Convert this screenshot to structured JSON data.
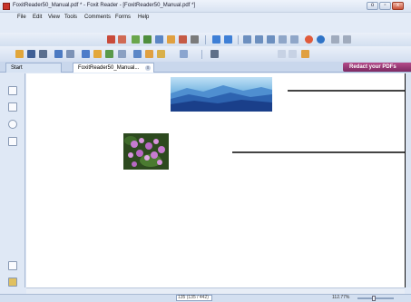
{
  "window": {
    "title": "FoxitReader50_Manual.pdf * - Foxit Reader - [FoxitReader50_Manual.pdf *]",
    "minimize": "o",
    "maximize": "▫",
    "close": "x"
  },
  "menu": [
    "File",
    "Edit",
    "View",
    "Tools",
    "Comments",
    "Forms",
    "Help"
  ],
  "tabs": {
    "start": "Start",
    "doc": "FoxitReader50_Manual...",
    "doc_close": "x"
  },
  "promo": {
    "label": "Redact your PDFs"
  },
  "status": {
    "page_field": "135 (135 / 442)",
    "zoom": "112.77%"
  },
  "colors": {
    "accent_redact": "#9b3b78",
    "frame": "#dfe8f6",
    "document": "#ffffff"
  },
  "icons": [
    "app-icon",
    "find-icon",
    "hand-icon",
    "select-icon",
    "zoom-icon",
    "previous-icon",
    "next-icon",
    "bookmark-icon",
    "pages-icon",
    "comment-icon",
    "attachment-icon"
  ]
}
